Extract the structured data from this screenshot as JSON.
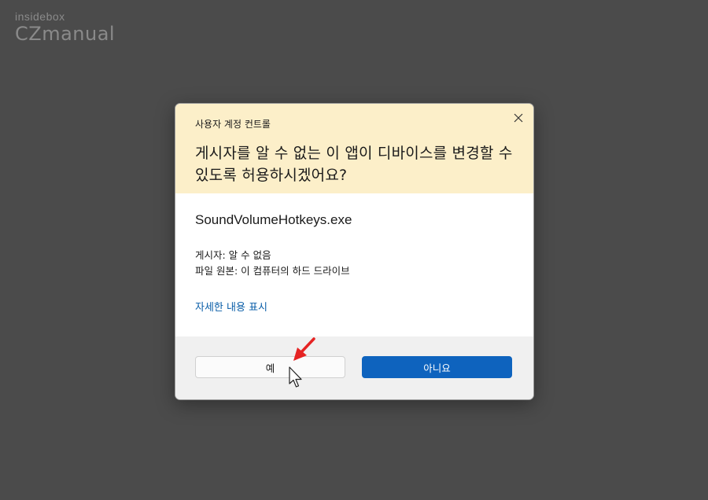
{
  "watermark": {
    "small": "insidebox",
    "big": "CZmanual"
  },
  "dialog": {
    "title": "사용자 계정 컨트롤",
    "question": "게시자를 알 수 없는 이 앱이 디바이스를 변경할 수 있도록 허용하시겠어요?",
    "program_name": "SoundVolumeHotkeys.exe",
    "publisher": "게시자: 알 수 없음",
    "origin": "파일 원본: 이 컴퓨터의 하드 드라이브",
    "details_link": "자세한 내용 표시",
    "yes_label": "예",
    "no_label": "아니요"
  },
  "icons": {
    "close": "close-icon",
    "arrow": "red-arrow-pointer",
    "cursor": "mouse-cursor-hand"
  },
  "colors": {
    "background": "#4b4b4b",
    "header": "#fcefc9",
    "primary_button": "#0e63be",
    "link": "#0a5ea8",
    "arrow": "#e52323"
  }
}
